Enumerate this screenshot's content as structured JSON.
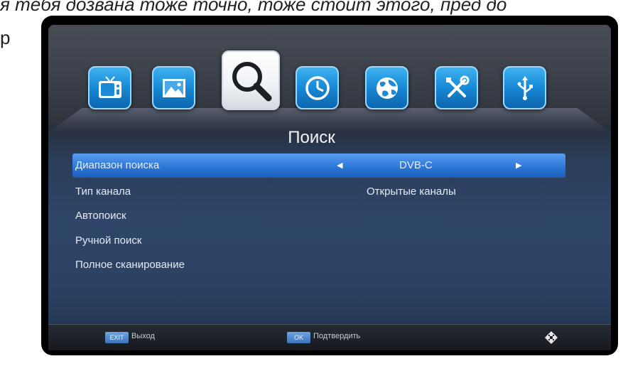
{
  "background_text": {
    "line1": "я тебя дозвана тоже точно, тоже стоит этого, пред до",
    "line2": "р"
  },
  "tabs": [
    {
      "name": "tv",
      "icon": "tv-icon"
    },
    {
      "name": "picture",
      "icon": "picture-icon"
    },
    {
      "name": "search",
      "icon": "search-icon",
      "active": true
    },
    {
      "name": "time",
      "icon": "clock-icon"
    },
    {
      "name": "network",
      "icon": "globe-icon"
    },
    {
      "name": "tools",
      "icon": "tools-icon"
    },
    {
      "name": "usb",
      "icon": "usb-icon"
    }
  ],
  "screen": {
    "title": "Поиск"
  },
  "menu": {
    "items": [
      {
        "label": "Диапазон поиска",
        "value": "DVB-C",
        "selected": true
      },
      {
        "label": "Тип канала",
        "value": "Открытые каналы"
      },
      {
        "label": "Автопоиск"
      },
      {
        "label": "Ручной поиск"
      },
      {
        "label": "Полное сканирование"
      }
    ]
  },
  "footer": {
    "exit_key": "EXIT",
    "exit_label": "Выход",
    "ok_key": "OK",
    "ok_label": "Подтвердить",
    "nav_icon": "navigation-icon"
  },
  "colors": {
    "accent": "#2d77d8",
    "icon_tile": "#1789d6",
    "background_top": "#3b4049",
    "background_bottom": "#2c4263"
  }
}
